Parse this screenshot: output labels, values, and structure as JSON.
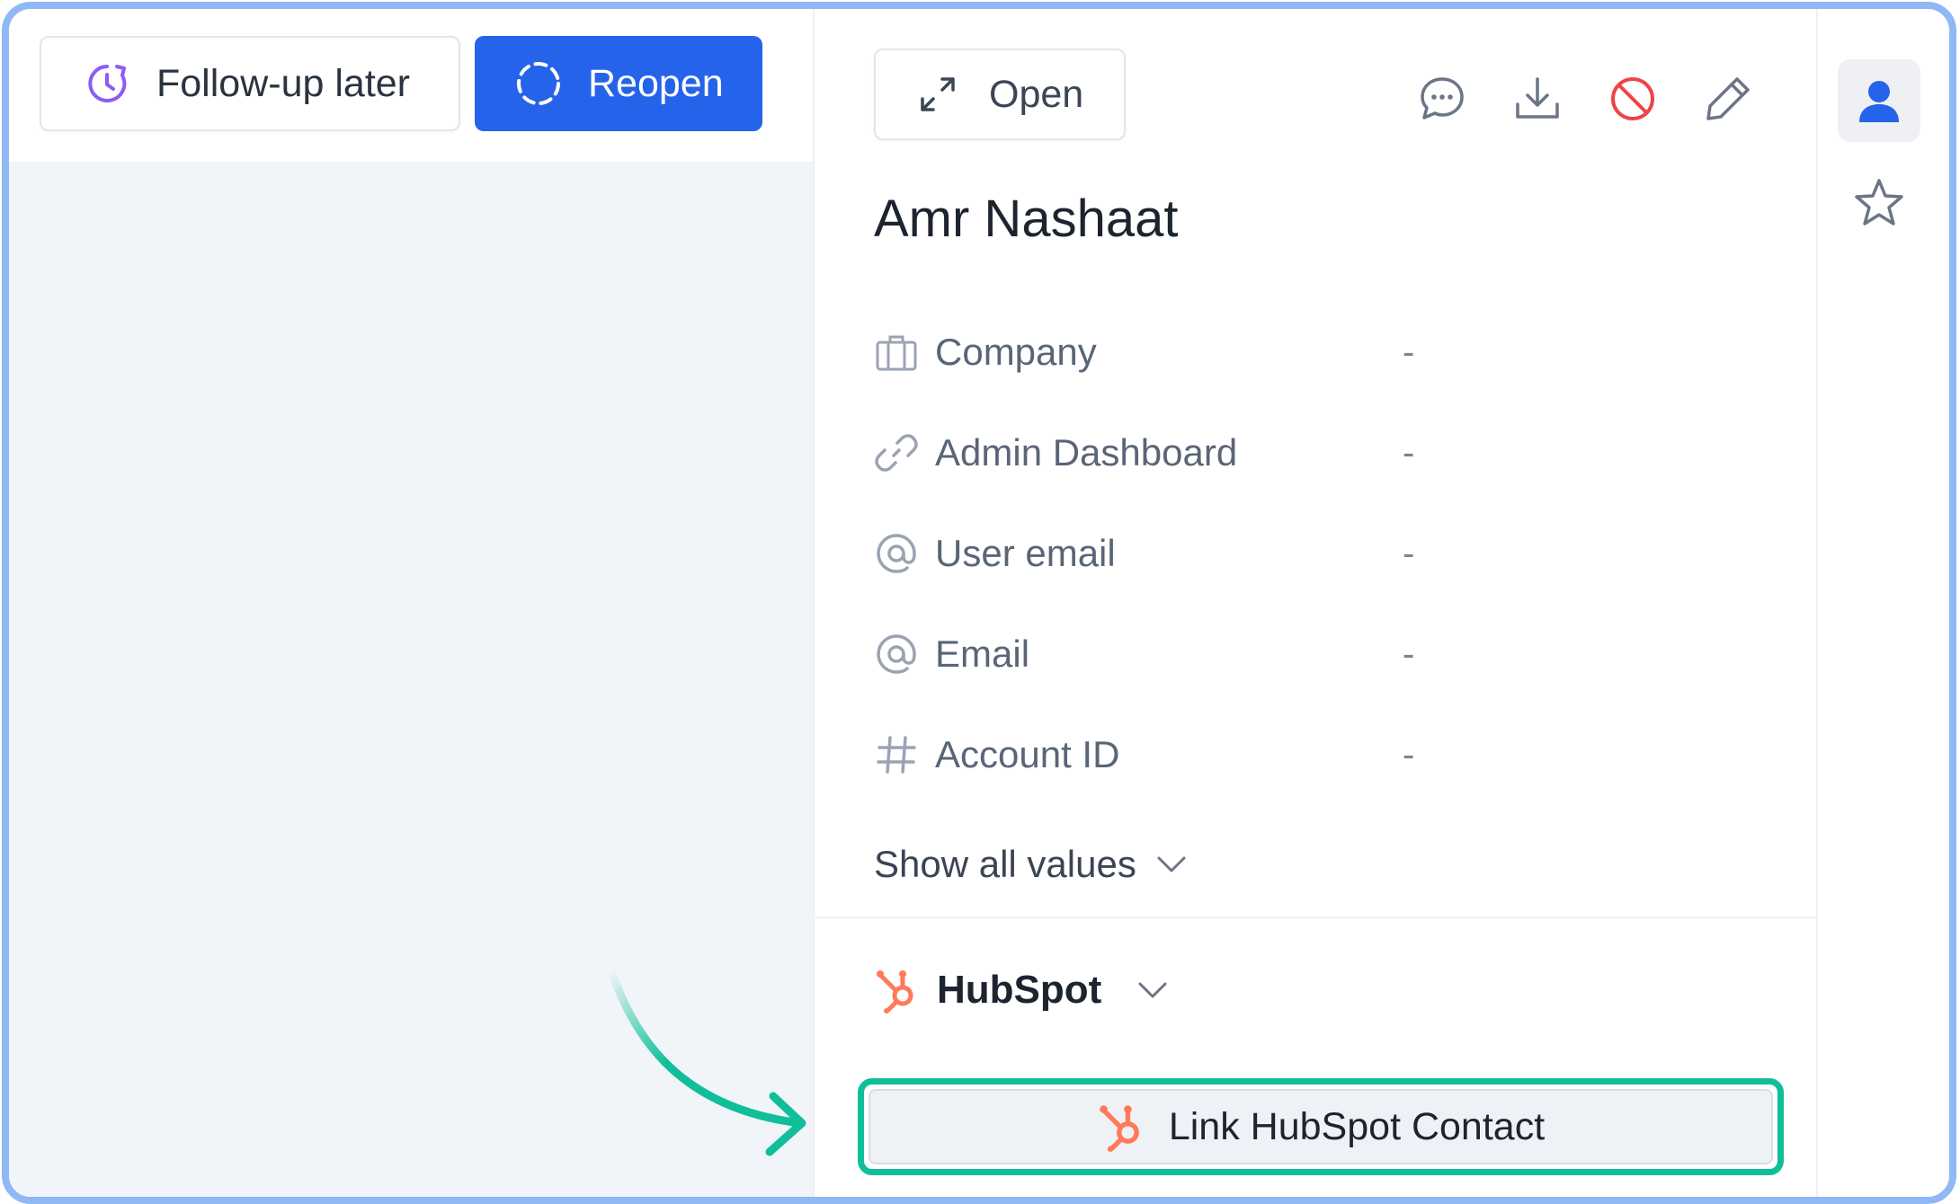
{
  "toolbar": {
    "followup_label": "Follow-up later",
    "reopen_label": "Reopen"
  },
  "details": {
    "open_label": "Open",
    "contact_name": "Amr Nashaat",
    "attributes": [
      {
        "label": "Company",
        "value": "-",
        "icon": "briefcase-icon"
      },
      {
        "label": "Admin Dashboard",
        "value": "-",
        "icon": "link-icon"
      },
      {
        "label": "User email",
        "value": "-",
        "icon": "at-icon"
      },
      {
        "label": "Email",
        "value": "-",
        "icon": "at-icon"
      },
      {
        "label": "Account ID",
        "value": "-",
        "icon": "hash-icon"
      }
    ],
    "show_all_label": "Show all values",
    "hubspot_title": "HubSpot",
    "link_hubspot_label": "Link HubSpot Contact"
  },
  "colors": {
    "primary": "#2563eb",
    "followup_icon": "#8b5cf6",
    "block_icon": "#ef4444",
    "hubspot": "#ff7a59",
    "highlight": "#10bf9a"
  }
}
